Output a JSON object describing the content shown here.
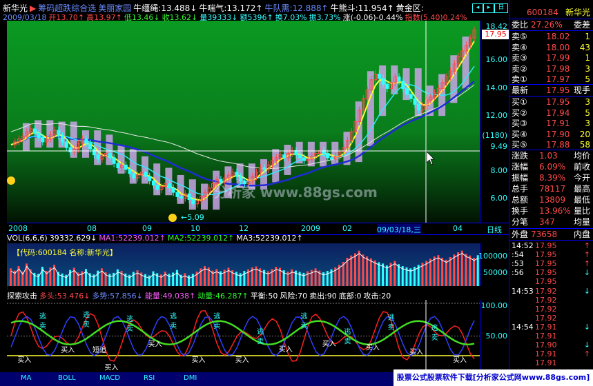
{
  "topbar": {
    "line1": [
      {
        "text": "新华光",
        "color": "wht"
      },
      {
        "text": "▶",
        "color": "red"
      },
      {
        "text": "筹码超跌综合选",
        "color": "blu"
      },
      {
        "text": "美丽家园",
        "color": "blu"
      },
      {
        "text": "牛缰绳:13.488↓",
        "color": "wht"
      },
      {
        "text": "牛喘气:13.172↑",
        "color": "wht"
      },
      {
        "text": "牛队需:12.888↑",
        "color": "blu"
      },
      {
        "text": "牛熊斗:11.954↑",
        "color": "wht"
      },
      {
        "text": "黄金区:",
        "color": "wht"
      }
    ],
    "line2": [
      {
        "text": "2009/03/18",
        "color": "blu"
      },
      {
        "text": "开13.70↑",
        "color": "red"
      },
      {
        "text": "高13.97↑",
        "color": "red"
      },
      {
        "text": "低13.46↓",
        "color": "grn"
      },
      {
        "text": "收13.62↓",
        "color": "grn"
      },
      {
        "text": "量39333↓",
        "color": "cyn"
      },
      {
        "text": "额5396↑",
        "color": "cyn"
      },
      {
        "text": "换7.03%",
        "color": "cyn"
      },
      {
        "text": "振3.73%",
        "color": "cyn"
      },
      {
        "text": "涨(-0.06)-0.44%",
        "color": "wht"
      },
      {
        "text": "指数(5.40)0.24%",
        "color": "red"
      }
    ],
    "icons": [
      "◂",
      "▸",
      "日"
    ]
  },
  "price_axis": {
    "labels": [
      "18.42",
      "16.00",
      "14.00",
      "12.00",
      "(1180)",
      "9.49",
      "8.00",
      "6.00"
    ],
    "current": "17.95"
  },
  "date_axis": {
    "labels": [
      "2008",
      "08",
      "09",
      "10",
      "12",
      "2009",
      "02",
      "09/03/18,三",
      "04"
    ],
    "period": "日线"
  },
  "volume": {
    "header": [
      {
        "text": "VOL(6,6,6)",
        "color": "wht"
      },
      {
        "text": "39332.629↓",
        "color": "wht"
      },
      {
        "text": "MA1:52239.012↑",
        "color": "mag"
      },
      {
        "text": "MA2:52239.012↑",
        "color": "grn"
      },
      {
        "text": "MA3:52239.012↑",
        "color": "wht"
      }
    ],
    "label": "【代码:600184 名称:新华光】",
    "axis": [
      "100000",
      "50000"
    ]
  },
  "indicator": {
    "header": [
      {
        "text": "探索攻击",
        "color": "wht"
      },
      {
        "text": "多头:53.476↓",
        "color": "red"
      },
      {
        "text": "多势:57.856↓",
        "color": "blu"
      },
      {
        "text": "能量:49.038↑",
        "color": "mag"
      },
      {
        "text": "动量:46.287↑",
        "color": "grn"
      },
      {
        "text": "平衡:50",
        "color": "wht"
      },
      {
        "text": "风险:70",
        "color": "wht"
      },
      {
        "text": "卖出:90",
        "color": "wht"
      },
      {
        "text": "底部:0",
        "color": "wht"
      },
      {
        "text": "攻击:20",
        "color": "wht"
      }
    ],
    "axis": [
      "100.00",
      "50.00"
    ],
    "buy_label": "买入",
    "escape_label": "逃",
    "sell_label": "卖",
    "chase_label": "短追"
  },
  "chart_annotations": {
    "low_mark": "5.09",
    "watermark": "分析家 www.88gs.com"
  },
  "tabs": [
    "MA",
    "BOLL",
    "MACD",
    "RSI",
    "DMI"
  ],
  "footer_watermark": "股票公式股票软件下载[分析家公式网www.88gs.com]",
  "panel": {
    "code": "600184",
    "name": "新华光",
    "ratio_label": "委比",
    "ratio": "27.26%",
    "diff_label": "委差",
    "asks": [
      {
        "label": "卖⑤",
        "price": "18.02",
        "vol": "1"
      },
      {
        "label": "卖④",
        "price": "18.00",
        "vol": "43"
      },
      {
        "label": "卖③",
        "price": "17.99",
        "vol": "1"
      },
      {
        "label": "卖②",
        "price": "17.98",
        "vol": "3"
      },
      {
        "label": "卖①",
        "price": "17.97",
        "vol": "5"
      }
    ],
    "last_label": "最新",
    "last": "17.95",
    "last_right": "现手",
    "bids": [
      {
        "label": "买①",
        "price": "17.95",
        "vol": "3"
      },
      {
        "label": "买②",
        "price": "17.94",
        "vol": "5"
      },
      {
        "label": "买③",
        "price": "17.91",
        "vol": "3"
      },
      {
        "label": "买④",
        "price": "17.90",
        "vol": "20"
      },
      {
        "label": "买⑤",
        "price": "17.88",
        "vol": "58"
      }
    ],
    "stats": [
      {
        "label": "涨跌",
        "value": "1.03",
        "right": "均价"
      },
      {
        "label": "涨幅",
        "value": "6.09%",
        "right": "前收"
      },
      {
        "label": "振幅",
        "value": "8.39%",
        "right": "今开"
      },
      {
        "label": "总手",
        "value": "78117",
        "right": "最高"
      },
      {
        "label": "总额",
        "value": "13809",
        "right": "最低"
      },
      {
        "label": "换手",
        "value": "13.96%",
        "right": "量比"
      },
      {
        "label": "分笔",
        "value": "347",
        "right": "均量"
      }
    ],
    "outer_label": "外盘",
    "outer": "73658",
    "inner_label": "内盘",
    "trades": [
      {
        "time": "14:52",
        "price": "17.95",
        "arrow": "↑"
      },
      {
        "time": ":54",
        "price": "17.95",
        "arrow": "↑"
      },
      {
        "time": ":53",
        "price": "17.95",
        "arrow": "↑"
      },
      {
        "time": ":56",
        "price": "17.95",
        "arrow": "↓"
      },
      {
        "time": "",
        "price": "17.95",
        "arrow": ""
      },
      {
        "time": "14:53",
        "price": "17.92",
        "arrow": "↓"
      },
      {
        "time": "",
        "price": "17.92",
        "arrow": ""
      },
      {
        "time": "",
        "price": "17.92",
        "arrow": ""
      },
      {
        "time": "",
        "price": "17.92",
        "arrow": ""
      },
      {
        "time": "14:54",
        "price": "17.91",
        "arrow": "↓"
      },
      {
        "time": "",
        "price": "17.91",
        "arrow": ""
      },
      {
        "time": "",
        "price": "17.90",
        "arrow": "↓"
      },
      {
        "time": "",
        "price": "17.91",
        "arrow": "↑"
      },
      {
        "time": "",
        "price": "17.91",
        "arrow": ""
      }
    ]
  },
  "colors": {
    "ma_white": "#e8e8e8",
    "ma_blue": "#1f2bd6",
    "ma_cyan": "#2fe9ff",
    "ma_yellow": "#ffff33",
    "chip": "#c9a6e6",
    "up": "#ff4a4a",
    "down": "#2fffff"
  },
  "chart_data": {
    "type": "line",
    "ylim": [
      4.6,
      18.6
    ],
    "close": [
      10.0,
      10.2,
      10.4,
      10.6,
      10.9,
      11.1,
      10.8,
      10.5,
      10.2,
      10.4,
      10.7,
      11.0,
      10.6,
      10.2,
      9.8,
      9.5,
      9.7,
      10.1,
      10.4,
      10.1,
      9.7,
      9.3,
      9.0,
      9.2,
      9.4,
      9.1,
      8.7,
      8.4,
      8.6,
      8.3,
      8.0,
      7.7,
      7.9,
      8.1,
      7.8,
      7.5,
      7.2,
      6.9,
      7.1,
      7.3,
      7.0,
      6.7,
      6.4,
      6.3,
      6.6,
      6.2,
      5.9,
      6.1,
      6.4,
      6.7,
      7.0,
      7.3,
      7.6,
      7.4,
      7.7,
      7.9,
      8.1,
      7.8,
      7.5,
      7.3,
      7.5,
      7.8,
      8.1,
      8.4,
      8.3,
      8.6,
      8.9,
      9.1,
      9.3,
      9.1,
      9.4,
      9.6,
      9.3,
      9.1,
      8.9,
      9.0,
      9.2,
      9.4,
      9.6,
      9.4,
      9.1,
      9.0,
      9.2,
      9.5,
      9.8,
      10.3,
      10.9,
      11.6,
      12.4,
      13.2,
      13.8,
      14.5,
      14.9,
      14.6,
      14.2,
      13.9,
      14.3,
      14.7,
      14.4,
      13.9,
      13.5,
      13.2,
      12.8,
      12.4,
      12.7,
      13.1,
      13.3,
      13.6,
      13.9,
      14.3,
      14.7,
      15.1,
      15.6,
      16.1,
      16.5,
      16.9,
      17.4,
      17.95
    ],
    "volume": [
      55,
      48,
      62,
      45,
      70,
      52,
      41,
      38,
      60,
      47,
      58,
      66,
      44,
      39,
      35,
      50,
      57,
      42,
      46,
      53,
      40,
      36,
      48,
      55,
      43,
      38,
      41,
      52,
      47,
      39,
      35,
      44,
      49,
      42,
      37,
      33,
      46,
      40,
      36,
      45,
      38,
      42,
      50,
      35,
      40,
      33,
      38,
      45,
      55,
      62,
      58,
      48,
      53,
      46,
      51,
      57,
      49,
      44,
      40,
      47,
      52,
      58,
      61,
      55,
      50,
      46,
      53,
      60,
      57,
      49,
      45,
      52,
      48,
      44,
      41,
      46,
      50,
      55,
      48,
      43,
      47,
      52,
      58,
      66,
      75,
      88,
      95,
      102,
      110,
      98,
      92,
      86,
      80,
      74,
      70,
      64,
      72,
      78,
      68,
      62,
      58,
      55,
      60,
      66,
      72,
      78,
      85,
      92,
      96,
      88,
      82,
      90,
      98,
      105,
      110,
      100,
      95,
      88,
      96
    ],
    "indicator_levels": [
      0,
      50,
      100
    ]
  }
}
